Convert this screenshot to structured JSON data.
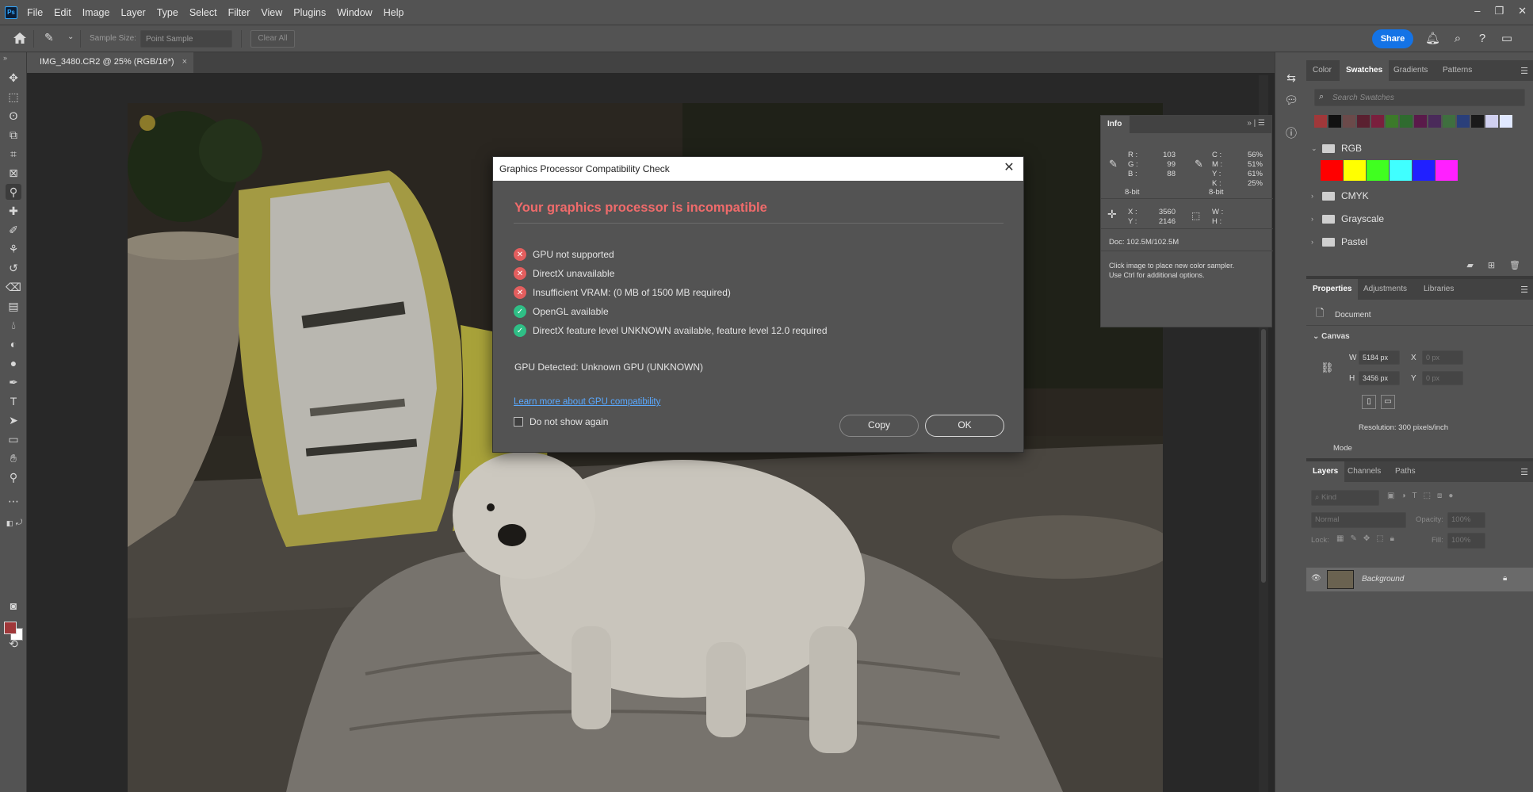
{
  "app": {
    "logo": "Ps",
    "menu": [
      "File",
      "Edit",
      "Image",
      "Layer",
      "Type",
      "Select",
      "Filter",
      "View",
      "Plugins",
      "Window",
      "Help"
    ]
  },
  "options_bar": {
    "sample_size_label": "Sample Size:",
    "sample_size_value": "Point Sample",
    "clear_all": "Clear All",
    "share": "Share"
  },
  "document": {
    "tab_title": "IMG_3480.CR2 @ 25% (RGB/16*)"
  },
  "info_panel": {
    "tab": "Info",
    "r_label": "R :",
    "r": "103",
    "g_label": "G :",
    "g": "99",
    "b_label": "B :",
    "b": "88",
    "bit_left": "8-bit",
    "c_label": "C :",
    "c": "56%",
    "m_label": "M :",
    "m": "51%",
    "y_label": "Y :",
    "y": "61%",
    "k_label": "K :",
    "k": "25%",
    "bit_right": "8-bit",
    "x_label": "X :",
    "x": "3560",
    "ycoord_label": "Y :",
    "ycoord": "2146",
    "w_label": "W :",
    "h_label": "H :",
    "doc": "Doc: 102.5M/102.5M",
    "hint_line1": "Click image to place new color sampler.",
    "hint_line2": "Use Ctrl for additional options."
  },
  "swatches_panel": {
    "tabs": [
      "Color",
      "Swatches",
      "Gradients",
      "Patterns"
    ],
    "active_tab": "Swatches",
    "search_placeholder": "Search Swatches",
    "recent_colors": [
      "#a0383a",
      "#111111",
      "#6b4a4a",
      "#5a2030",
      "#7a1f3d",
      "#3c7a2a",
      "#2f6b2f",
      "#5a1a4a",
      "#4a2a5a",
      "#3f6f3f",
      "#2a3f7a",
      "#1a1a1a",
      "#d0d0f0",
      "#e0e8ff"
    ],
    "groups": [
      {
        "name": "RGB",
        "expanded": true,
        "colors": [
          "#ff0000",
          "#ffff00",
          "#40ff20",
          "#40ffff",
          "#2020ff",
          "#ff20ff"
        ]
      },
      {
        "name": "CMYK",
        "expanded": false
      },
      {
        "name": "Grayscale",
        "expanded": false
      },
      {
        "name": "Pastel",
        "expanded": false
      }
    ]
  },
  "properties_panel": {
    "tabs": [
      "Properties",
      "Adjustments",
      "Libraries"
    ],
    "active_tab": "Properties",
    "doc_label": "Document",
    "canvas_header": "Canvas",
    "w_label": "W",
    "w_value": "5184 px",
    "x_label": "X",
    "x_placeholder": "0 px",
    "h_label": "H",
    "h_value": "3456 px",
    "y_label": "Y",
    "y_placeholder": "0 px",
    "resolution": "Resolution: 300 pixels/inch",
    "mode_label": "Mode"
  },
  "layers_panel": {
    "tabs": [
      "Layers",
      "Channels",
      "Paths"
    ],
    "active_tab": "Layers",
    "kind_placeholder": "Kind",
    "blend_mode": "Normal",
    "opacity_label": "Opacity:",
    "opacity_value": "100%",
    "lock_label": "Lock:",
    "fill_label": "Fill:",
    "fill_value": "100%",
    "layers": [
      {
        "name": "Background",
        "visible": true,
        "locked": true
      }
    ]
  },
  "dialog": {
    "title": "Graphics Processor Compatibility Check",
    "heading": "Your graphics processor is incompatible",
    "checks": [
      {
        "text": "GPU not supported",
        "status": "fail"
      },
      {
        "text": "DirectX unavailable",
        "status": "fail"
      },
      {
        "text": "Insufficient VRAM: (0 MB of 1500 MB required)",
        "status": "fail"
      },
      {
        "text": "OpenGL available",
        "status": "pass"
      },
      {
        "text": "DirectX feature level UNKNOWN available, feature level 12.0 required",
        "status": "pass"
      }
    ],
    "gpu_detected": "GPU Detected: Unknown GPU (UNKNOWN)",
    "learn_more": "Learn more about GPU compatibility",
    "do_not_show": "Do not show again",
    "copy_button": "Copy",
    "ok_button": "OK",
    "colors": {
      "error": "#f06b6b",
      "fail": "#e35e5e",
      "pass": "#2fbf86",
      "link": "#5aa9ff"
    }
  },
  "colors": {
    "foreground": "#a0383a",
    "background": "#ffffff",
    "accent": "#1473e6"
  }
}
